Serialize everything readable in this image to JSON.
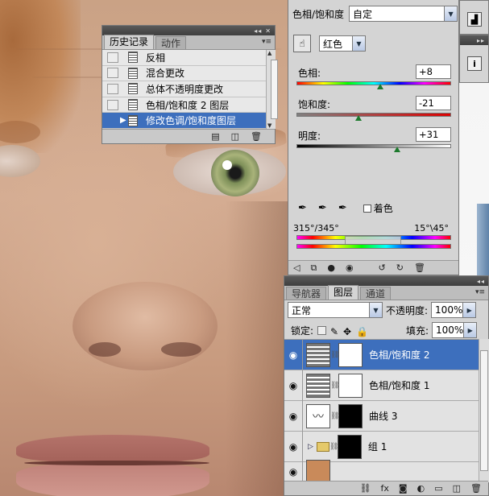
{
  "history_panel": {
    "tabs": [
      "历史记录",
      "动作"
    ],
    "items": [
      {
        "label": "反相",
        "selected": false
      },
      {
        "label": "混合更改",
        "selected": false
      },
      {
        "label": "总体不透明度更改",
        "selected": false
      },
      {
        "label": "色相/饱和度 2 图层",
        "selected": false
      },
      {
        "label": "修改色调/饱和度图层",
        "selected": true
      }
    ]
  },
  "adjustments_panel": {
    "title": "色相/饱和度",
    "preset": "自定",
    "channel": "红色",
    "hue": {
      "label": "色相:",
      "value": "+8",
      "position": 0.54
    },
    "saturation": {
      "label": "饱和度:",
      "value": "-21",
      "position": 0.4
    },
    "lightness": {
      "label": "明度:",
      "value": "+31",
      "position": 0.65
    },
    "colorize_label": "着色",
    "range_left": "315°/345°",
    "range_right": "15°\\45°"
  },
  "layers_panel": {
    "tabs": [
      "导航器",
      "图层",
      "通道"
    ],
    "active_tab": "图层",
    "blend_mode": "正常",
    "opacity_label": "不透明度:",
    "opacity_value": "100%",
    "lock_label": "锁定:",
    "fill_label": "填充:",
    "fill_value": "100%",
    "layers": [
      {
        "name": "色相/饱和度 2",
        "type": "hue-sat",
        "mask": "white",
        "selected": true
      },
      {
        "name": "色相/饱和度 1",
        "type": "hue-sat",
        "mask": "white",
        "selected": false
      },
      {
        "name": "曲线 3",
        "type": "curves",
        "mask": "black",
        "selected": false
      },
      {
        "name": "组 1",
        "type": "group",
        "mask": "black",
        "selected": false
      }
    ]
  },
  "colors": {
    "selection": "#3d6fbd",
    "panel_bg": "#d4d4d4"
  }
}
